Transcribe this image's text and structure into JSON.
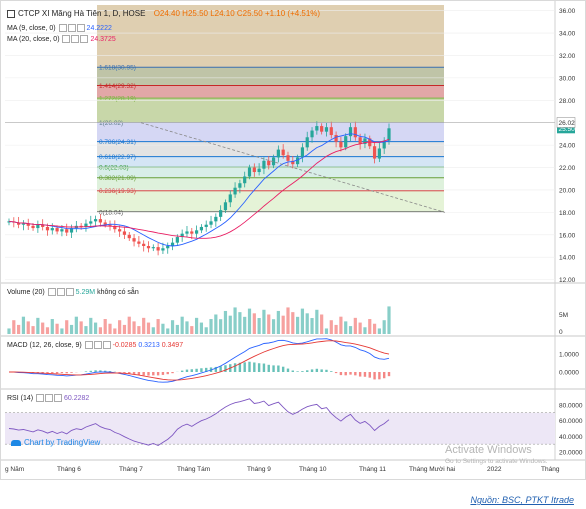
{
  "header": {
    "title": "CTCP XI Măng Hà Tiên 1, D, HOSE",
    "ohlc": [
      "O24.40",
      "H25.50",
      "L24.10",
      "C25.50",
      "+1.10 (+4.51%)"
    ],
    "ma9_label": "MA (9, close, 0)",
    "ma9_value": "24.2222",
    "ma20_label": "MA (20, close, 0)",
    "ma20_value": "24.3725"
  },
  "colors": {
    "up": "#26a69a",
    "down": "#ef5350",
    "ma9": "#2962ff",
    "ma20": "#e91e63",
    "macd": "#2962ff",
    "signal": "#e53935",
    "rsi": "#7e57c2",
    "trend": "#888888"
  },
  "fib": {
    "levels": [
      {
        "label": "1.618(30.95)",
        "price": 30.95,
        "color": "#3a6fb0"
      },
      {
        "label": "1.414(29.32)",
        "price": 29.32,
        "color": "#c62828"
      },
      {
        "label": "1.272(28.19)",
        "price": 28.19,
        "color": "#7cb342"
      },
      {
        "label": "1(26.02)",
        "price": 26.02,
        "color": "#607d8b"
      },
      {
        "label": "0.786(24.31)",
        "price": 24.31,
        "color": "#1976d2"
      },
      {
        "label": "0.618(22.97)",
        "price": 22.97,
        "color": "#1976d2"
      },
      {
        "label": "0.5(22.03)",
        "price": 22.03,
        "color": "#43a047"
      },
      {
        "label": "0.382(21.09)",
        "price": 21.09,
        "color": "#689f38"
      },
      {
        "label": "0.236(19.93)",
        "price": 19.93,
        "color": "#d32f2f"
      },
      {
        "label": "0(18.04)",
        "price": 18.04,
        "color": "#555555"
      }
    ]
  },
  "price_axis": {
    "ticks": [
      "36.00",
      "34.00",
      "32.00",
      "30.00",
      "28.00",
      "26.00",
      "24.00",
      "22.00",
      "20.00",
      "18.00",
      "16.00",
      "14.00",
      "12.00"
    ],
    "current_price": "25.50",
    "level_tag": "26.02"
  },
  "volume": {
    "label": "Volume (20)",
    "value": "5.29M",
    "note": "không có sẵn",
    "axis_ticks": [
      "5M",
      "0"
    ]
  },
  "macd": {
    "label": "MACD (12, 26, close, 9)",
    "values": [
      "-0.0285",
      "0.3213",
      "0.3497"
    ],
    "axis_ticks": [
      "1.0000",
      "0.0000"
    ]
  },
  "rsi": {
    "label": "RSI (14)",
    "value": "60.2282",
    "axis_ticks": [
      "80.0000",
      "60.0000",
      "40.0000",
      "20.0000"
    ]
  },
  "time_axis": {
    "labels": [
      "g Năm",
      "Tháng 6",
      "Tháng 7",
      "Tháng Tám",
      "Tháng 9",
      "Tháng 10",
      "Tháng 11",
      "Tháng Mười hai",
      "2022",
      "Tháng"
    ]
  },
  "watermark": "Chart by TradingView",
  "activate_windows": {
    "title": "Activate Windows",
    "subtitle": "Go to Settings to activate Windows."
  },
  "caption": "Nguồn: BSC, PTKT Itrade",
  "chart_data": {
    "type": "candlestick",
    "closes": [
      17.2,
      17.1,
      16.9,
      17.0,
      16.8,
      16.6,
      16.9,
      16.7,
      16.4,
      16.6,
      16.3,
      16.5,
      16.2,
      16.6,
      16.8,
      16.7,
      17.0,
      17.2,
      17.4,
      17.1,
      16.9,
      16.8,
      16.5,
      16.3,
      16.0,
      15.7,
      15.4,
      15.2,
      15.0,
      14.8,
      14.9,
      14.6,
      14.8,
      15.0,
      15.3,
      15.8,
      16.1,
      16.3,
      16.1,
      16.4,
      16.7,
      16.9,
      17.2,
      17.6,
      18.2,
      18.9,
      19.6,
      20.2,
      20.6,
      21.2,
      22.0,
      21.6,
      21.9,
      22.6,
      22.2,
      22.9,
      23.6,
      23.1,
      22.6,
      22.3,
      22.9,
      23.8,
      24.7,
      25.3,
      25.7,
      25.2,
      25.6,
      24.9,
      24.3,
      23.8,
      24.8,
      25.6,
      24.7,
      24.1,
      24.6,
      23.9,
      22.8,
      23.7,
      24.4,
      25.5
    ],
    "ma9_last": 24.2222,
    "ma20_last": 24.3725,
    "volume_last": "5.29M",
    "macd_last": [
      -0.0285,
      0.3213,
      0.3497
    ],
    "rsi_last": 60.2282
  }
}
